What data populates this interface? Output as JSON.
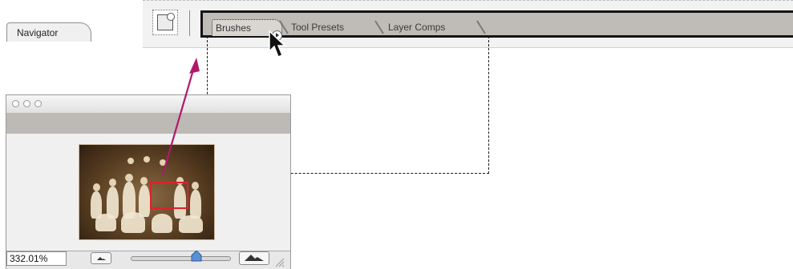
{
  "palette_well": {
    "tabs": [
      {
        "label": "Brushes"
      },
      {
        "label": "Tool Presets"
      },
      {
        "label": "Layer Comps"
      }
    ]
  },
  "navigator": {
    "tab_label": "Navigator",
    "zoom_value": "332.01%",
    "zoom_slider_fraction": 0.68,
    "icons": {
      "menu": "palette-menu-icon",
      "zoom_out": "zoom-out-mountain-icon",
      "zoom_in": "zoom-in-mountain-icon"
    }
  },
  "colors": {
    "arrow": "#b3176a",
    "view_box": "#e0212b",
    "tab_row": "#bdb9b5"
  }
}
